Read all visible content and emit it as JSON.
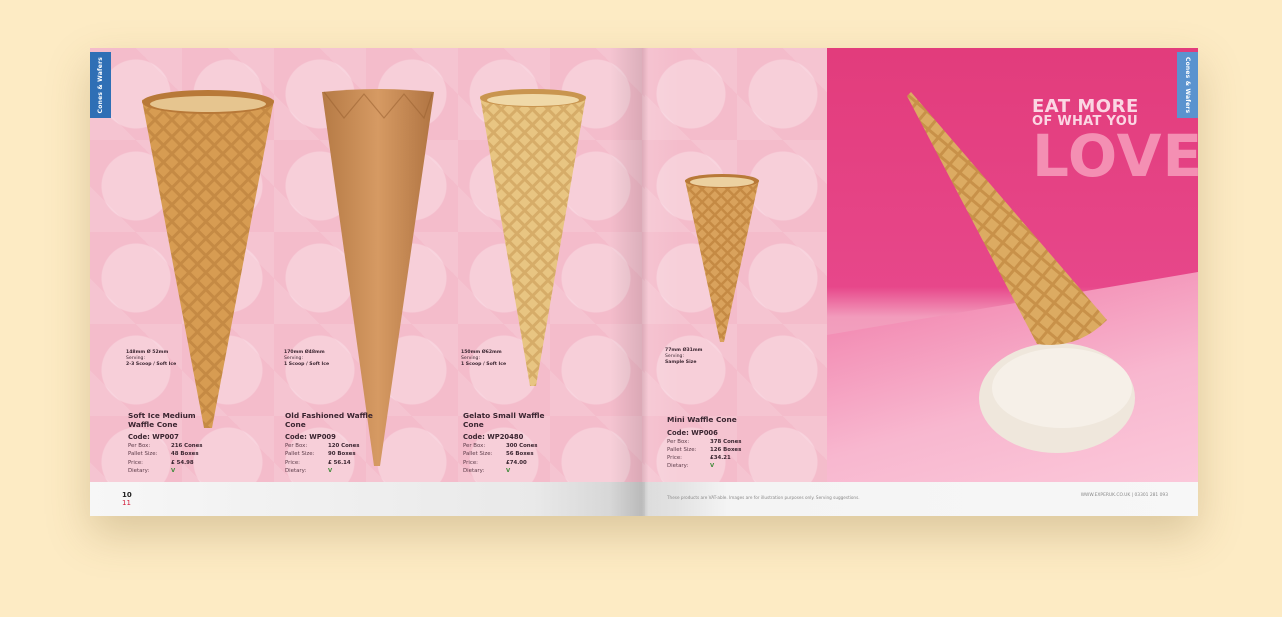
{
  "section_tab": "Cones & Wafers",
  "page_numbers": {
    "current": "10",
    "next": "11"
  },
  "products": [
    {
      "dim": "148mm Ø 52mm",
      "serving_label": "Serving:",
      "serving": "2-3 Scoop / Soft Ice",
      "name": "Soft Ice Medium Waffle Cone",
      "code": "Code: WP007",
      "per_box_label": "Per Box:",
      "per_box": "216 Cones",
      "pallet_label": "Pallet Size:",
      "pallet": "48 Boxes",
      "price_label": "Price:",
      "price": "£ 54.98",
      "dietary_label": "Dietary:",
      "dietary": "V"
    },
    {
      "dim": "170mm Ø48mm",
      "serving_label": "Serving:",
      "serving": "1 Scoop / Soft Ice",
      "name": "Old Fashioned Waffle Cone",
      "code": "Code: WP009",
      "per_box_label": "Per Box:",
      "per_box": "120 Cones",
      "pallet_label": "Pallet Size:",
      "pallet": "90 Boxes",
      "price_label": "Price:",
      "price": "£ 56.14",
      "dietary_label": "Dietary:",
      "dietary": "V"
    },
    {
      "dim": "150mm Ø62mm",
      "serving_label": "Serving:",
      "serving": "1 Scoop / Soft Ice",
      "name": "Gelato Small Waffle Cone",
      "code": "Code: WP20480",
      "per_box_label": "Per Box:",
      "per_box": "300 Cones",
      "pallet_label": "Pallet Size:",
      "pallet": "56 Boxes",
      "price_label": "Price:",
      "price": "£74.00",
      "dietary_label": "Dietary:",
      "dietary": "V"
    },
    {
      "dim": "77mm Ø31mm",
      "serving_label": "Serving:",
      "serving": "Sample Size",
      "name": "Mini Waffle Cone",
      "code": "Code: WP006",
      "per_box_label": "Per Box:",
      "per_box": "378 Cones",
      "pallet_label": "Pallet Size:",
      "pallet": "126 Boxes",
      "price_label": "Price:",
      "price": "£34.21",
      "dietary_label": "Dietary:",
      "dietary": "V"
    }
  ],
  "headline": {
    "line1": "EAT MORE",
    "line2": "OF WHAT YOU",
    "line3": "LOVE"
  },
  "footer": {
    "disclaimer": "These products are VAT-able. Images are for illustration purposes only. Serving suggestions.",
    "website": "WWW.EXPERUK.CO.UK | 03301 281 093"
  },
  "colors": {
    "tab": "#2f6fb5",
    "pink_bg": "#f4bccb",
    "hot_pink": "#e23c7c",
    "page_number_red": "#d21f3c"
  }
}
